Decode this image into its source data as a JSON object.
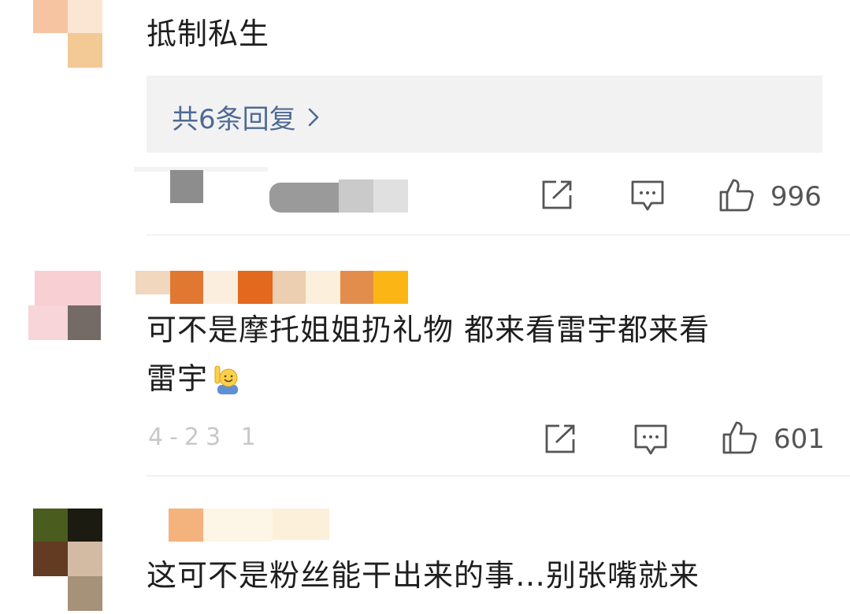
{
  "comments": [
    {
      "text": "抵制私生",
      "replies_label": "共6条回复",
      "likes": "996"
    },
    {
      "text_line1": "可不是摩托姐姐扔礼物 都来看雷宇都来看",
      "text_line2": "雷宇",
      "timestamp": "4-23 1",
      "likes": "601"
    },
    {
      "text": "这可不是粉丝能干出来的事…别张嘴就来"
    }
  ],
  "icons": {
    "share": "share-icon",
    "comment": "comment-icon",
    "like": "thumbs-up-icon",
    "reply_arrow": "chevron-right-icon",
    "emoji": "raising-hand-emoji-icon"
  },
  "colors": {
    "link": "#4e6a96",
    "reply_bg": "#f2f2f2"
  }
}
